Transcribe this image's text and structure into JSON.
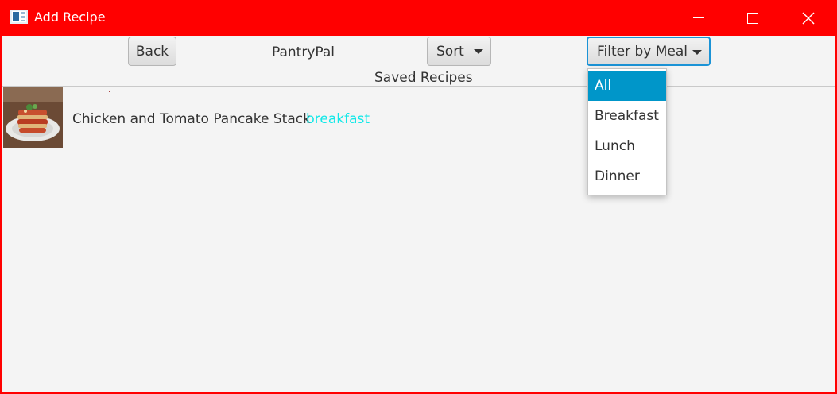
{
  "window": {
    "title": "Add Recipe"
  },
  "toolbar": {
    "back_label": "Back",
    "app_name": "PantryPal",
    "sort_label": "Sort",
    "filter_label": "Filter by Meal"
  },
  "section_title": "Saved Recipes",
  "recipes": [
    {
      "name": "Chicken and Tomato Pancake Stack",
      "meal": "breakfast"
    }
  ],
  "filter_menu": {
    "items": [
      "All",
      "Breakfast",
      "Lunch",
      "Dinner"
    ],
    "selected": "All"
  },
  "colors": {
    "titlebar": "#ff0000",
    "selected_item": "#0096c9",
    "meal_tag": "#12e8e8",
    "focus_border": "#1b93d6"
  }
}
